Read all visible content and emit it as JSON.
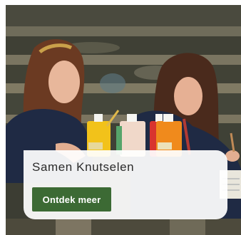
{
  "card": {
    "title": "Samen Knutselen",
    "cta_label": "Ontdek meer"
  },
  "colors": {
    "cta_background": "#3c6a34",
    "cta_text": "#ffffff",
    "title_text": "#2b2b2b",
    "overlay_background": "#ffffff"
  },
  "image": {
    "icon": "photo-crafting-scene"
  }
}
